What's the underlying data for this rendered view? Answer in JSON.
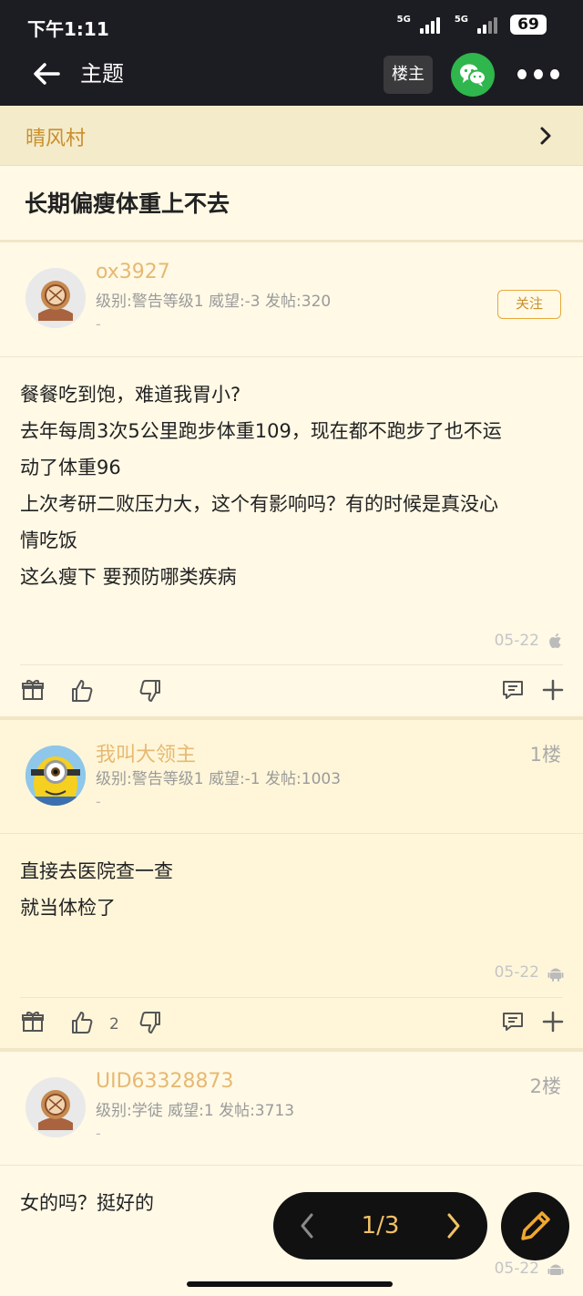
{
  "status_bar": {
    "time": "下午1:11",
    "network1": "5G",
    "network2": "5G",
    "battery": "69"
  },
  "nav": {
    "title": "主题",
    "owner_label": "楼主",
    "back_icon": "arrow-left-icon",
    "wechat_icon": "wechat-icon",
    "more_icon": "more-dots-icon"
  },
  "forum": {
    "name": "晴风村",
    "chevron_icon": "chevron-right-icon"
  },
  "topic": {
    "title": "长期偏瘦体重上不去"
  },
  "posts": [
    {
      "username": "ox3927",
      "meta": "级别:警告等级1 威望:-3 发帖:320",
      "dash": "-",
      "follow_label": "关注",
      "lines": [
        "餐餐吃到饱，难道我胃小?",
        "去年每周3次5公里跑步体重109，现在都不跑步了也不运",
        "动了体重96",
        "上次考研二败压力大，这个有影响吗？有的时候是真没心",
        "情吃饭",
        "这么瘦下 要预防哪类疾病"
      ],
      "date": "05-22",
      "device_icon": "apple-icon",
      "like_count": ""
    },
    {
      "username": "我叫大领主",
      "meta": "级别:警告等级1 威望:-1 发帖:1003",
      "dash": "-",
      "floor": "1楼",
      "lines": [
        "直接去医院查一查",
        "就当体检了"
      ],
      "date": "05-22",
      "device_icon": "android-icon",
      "like_count": "2"
    },
    {
      "username": "UID63328873",
      "meta": "级别:学徒 威望:1 发帖:3713",
      "dash": "-",
      "floor": "2楼",
      "lines": [
        "女的吗？挺好的"
      ],
      "date": "05-22",
      "device_icon": "android-icon"
    }
  ],
  "pager": {
    "label": "1/3"
  },
  "colors": {
    "accent": "#E6B972",
    "forum_name": "#C98F2C",
    "background": "#FFF9E6",
    "topbar": "#1C1D22",
    "wechat": "#2FB64C"
  }
}
